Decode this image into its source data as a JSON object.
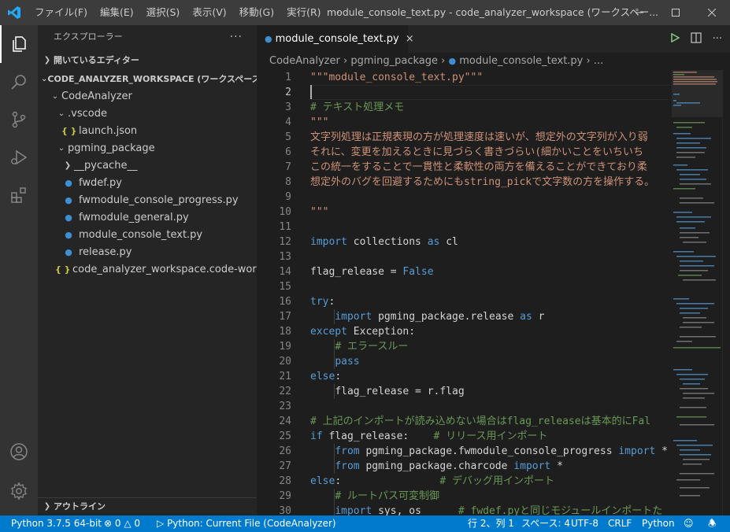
{
  "titlebar": {
    "menus": [
      "ファイル(F)",
      "編集(E)",
      "選択(S)",
      "表示(V)",
      "移動(G)",
      "実行(R)",
      "···"
    ],
    "title": "module_console_text.py - code_analyzer_workspace (ワークスペー..."
  },
  "sidebar": {
    "header": "エクスプローラー",
    "more": "···",
    "open_editors": "開いているエディター",
    "workspace": "CODE_ANALYZER_WORKSPACE (ワークスペース)",
    "tree": [
      {
        "label": "CodeAnalyzer",
        "type": "folder-open"
      },
      {
        "label": ".vscode",
        "type": "folder-open"
      },
      {
        "label": "launch.json",
        "type": "json"
      },
      {
        "label": "pgming_package",
        "type": "folder-open"
      },
      {
        "label": "__pycache__",
        "type": "folder-closed"
      },
      {
        "label": "fwdef.py",
        "type": "py"
      },
      {
        "label": "fwmodule_console_progress.py",
        "type": "py"
      },
      {
        "label": "fwmodule_general.py",
        "type": "py"
      },
      {
        "label": "module_console_text.py",
        "type": "py"
      },
      {
        "label": "release.py",
        "type": "py"
      },
      {
        "label": "code_analyzer_workspace.code-worksp...",
        "type": "json"
      }
    ],
    "outline": "アウトライン"
  },
  "editor": {
    "tab_label": "module_console_text.py",
    "tab_close": "×",
    "breadcrumb": [
      "CodeAnalyzer",
      "pgming_package",
      "module_console_text.py",
      "..."
    ],
    "line_numbers": [
      "1",
      "2",
      "3",
      "4",
      "5",
      "6",
      "7",
      "8",
      "9",
      "10",
      "11",
      "12",
      "13",
      "14",
      "15",
      "16",
      "17",
      "18",
      "19",
      "20",
      "21",
      "22",
      "23",
      "24",
      "25",
      "26",
      "27",
      "28",
      "29",
      "30"
    ],
    "code": {
      "l1": "\"\"\"module_console_text.py\"\"\"",
      "l3": "# テキスト処理メモ",
      "l4": "\"\"\"",
      "l5": "文字列処理は正規表現の方が処理速度は速いが、想定外の文字列が入り弱",
      "l6": "それに、変更を加えるときに見づらく書きづらい(細かいことをいちいち",
      "l7": "この統一をすることで一貫性と柔軟性の両方を備えることができており柔",
      "l8": "想定外のバグを回避するためにもstring_pickで文字数の方を操作する。",
      "l9": "\"\"\"",
      "import": "import",
      "collections": " collections ",
      "as": "as",
      "cl": " cl",
      "flag_release_eq": "flag_release = ",
      "false": "False",
      "try": "try",
      "colon": ":",
      "import_pkg": " pgming_package.release ",
      "r": " r",
      "except": "except",
      "exception": " Exception:",
      "cm_error": "# エラースルー",
      "pass": "pass",
      "else": "else",
      "flag_assign": "flag_release = r.flag",
      "cm_import": "# 上記のインポートが読み込めない場合はflag_releaseは基本的にFal",
      "if": "if",
      "if_cond": " flag_release:    ",
      "cm_release": "# リリース用インポート",
      "from": "from",
      "progress_mod": " pgming_package.fwmodule_console_progress ",
      "star": " *",
      "charcode_mod": " pgming_package.charcode ",
      "cm_debug": "# デバッグ用インポート",
      "cm_route": "# ルートパス可変制御",
      "sys_os": " sys, os      ",
      "cm_fwdef": "# fwdef.pyと同じモジュールインポートた"
    }
  },
  "statusbar": {
    "python": "Python 3.7.5 64-bit",
    "errors": "0",
    "warnings": "0",
    "run_config": "Python: Current File (CodeAnalyzer)",
    "position": "行 2、列 1",
    "spaces": "スペース: 4",
    "encoding": "UTF-8",
    "eol": "CRLF",
    "language": "Python"
  }
}
